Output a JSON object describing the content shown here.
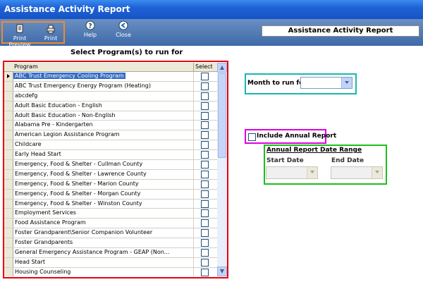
{
  "window": {
    "title": "Assistance Activity Report"
  },
  "toolbar": {
    "print_preview": "Print Preview",
    "print": "Print",
    "help": "Help",
    "close": "Close",
    "header": "Assistance Activity Report"
  },
  "programs": {
    "label": "Select Program(s) to run for",
    "col_program": "Program",
    "col_select": "Select",
    "items": [
      "ABC Trust Emergency Cooling Program",
      "ABC Trust Emergency Energy Program (Heating)",
      "abcdefg",
      "Adult Basic Education - English",
      "Adult Basic Education - Non-English",
      "Alabama Pre - Kindergarten",
      "American Legion Assistance Program",
      "Childcare",
      "Early Head Start",
      "Emergency, Food & Shelter - Cullman County",
      "Emergency, Food & Shelter - Lawrence County",
      "Emergency, Food & Shelter - Marion County",
      "Emergency, Food & Shelter - Morgan County",
      "Emergency, Food & Shelter - Winston County",
      "Employment Services",
      "Food Assistance Program",
      "Foster Grandparent\\Senior Companion Volunteer",
      "Foster Grandparents",
      "General Emergency Assistance Program - GEAP (Non...",
      "Head Start",
      "Housing Counseling"
    ],
    "selected_index": 0
  },
  "month": {
    "label": "Month to run for",
    "value": ""
  },
  "annual": {
    "label": "Include Annual Report",
    "checked": false
  },
  "range": {
    "title": "Annual Report Date Range",
    "start_label": "Start Date",
    "end_label": "End Date"
  },
  "colors": {
    "titlebar": "#1f62d6",
    "toolbar": "#4a73ad",
    "selection": "#316ac5",
    "highlight_programs": "#e8000d",
    "highlight_month": "#18b8b0",
    "highlight_annual": "#e000e0",
    "highlight_range": "#1ac01a",
    "highlight_toolbar": "#f08a2a"
  }
}
